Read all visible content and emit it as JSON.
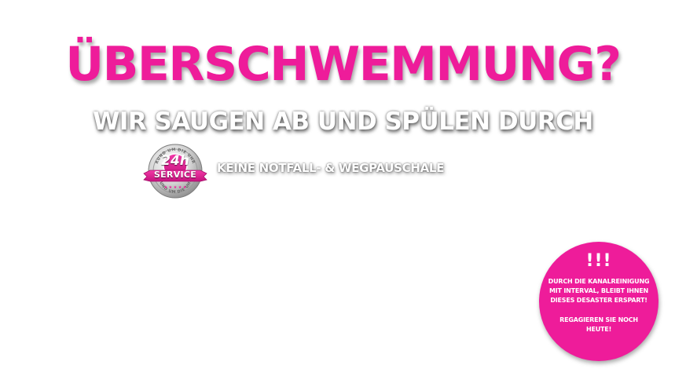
{
  "headline": "ÜBERSCHWEMMUNG?",
  "subline": "WIR SAUGEN AB UND SPÜLEN DURCH",
  "badge": {
    "top_arc_text": "RUND UM DIE UHR",
    "main": "24h",
    "ribbon": "SERVICE",
    "bottom_arc_text": "RUND UM DIE UHR"
  },
  "tagline": "KEINE NOTFALL- & WEGPAUSCHALE",
  "promo_circle": {
    "exclamation": "!!!",
    "message": "DURCH DIE KANALREINIGUNG MIT INTERVAL, BLEIBT IHNEN DIESES DESASTER ERSPART!",
    "call_to_action": "REGAGIEREN SIE NOCH HEUTE!"
  },
  "colors": {
    "accent_pink": "#ee1c9a",
    "background": "#ffffff",
    "text_white": "#ffffff"
  }
}
